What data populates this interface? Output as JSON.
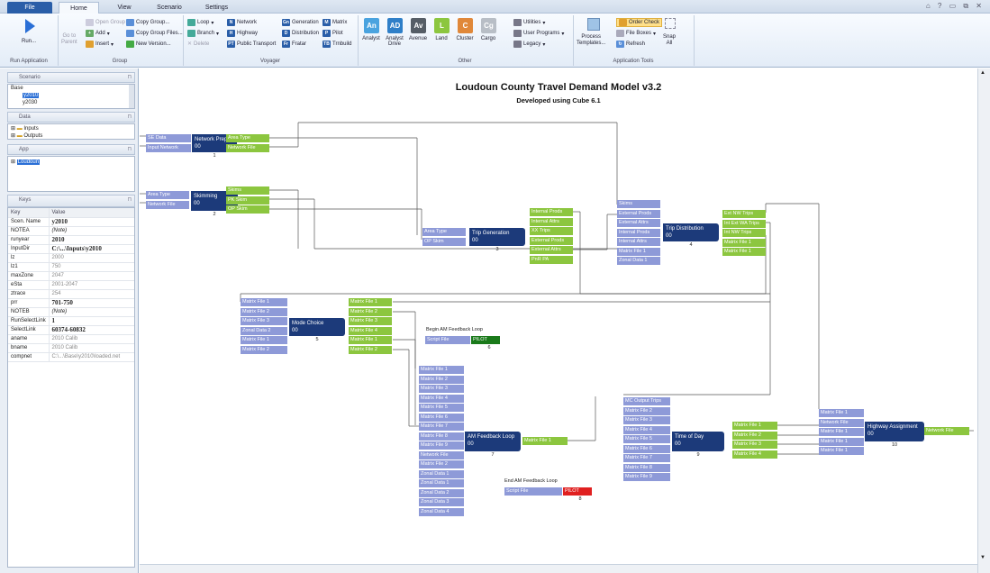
{
  "tabs": {
    "file": "File",
    "home": "Home",
    "view": "View",
    "scenario": "Scenario",
    "settings": "Settings"
  },
  "ribbon": {
    "run": "Run...",
    "run_group": "Run Application",
    "go_parent": "Go to\nParent",
    "open_group": "Open Group",
    "add": "Add",
    "insert": "Insert",
    "copy_group": "Copy Group...",
    "copy_group_files": "Copy Group Files...",
    "new_version": "New Version...",
    "group_caption": "Group",
    "loop": "Loop",
    "branch": "Branch",
    "delete": "Delete",
    "network": "Network",
    "highway": "Highway",
    "public_transport": "Public Transport",
    "generation": "Generation",
    "distribution": "Distribution",
    "fratar": "Fratar",
    "matrix": "Matrix",
    "pilot": "Pilot",
    "trnbuild": "Trnbuild",
    "voyager_caption": "Voyager",
    "tiles": [
      {
        "abbr": "An",
        "label": "Analyst",
        "color": "#4aa3df"
      },
      {
        "abbr": "AD",
        "label": "Analyst Drive",
        "color": "#2f7fc8"
      },
      {
        "abbr": "Av",
        "label": "Avenue",
        "color": "#555d66"
      },
      {
        "abbr": "L",
        "label": "Land",
        "color": "#8cc63f"
      },
      {
        "abbr": "C",
        "label": "Cluster",
        "color": "#e0883a"
      },
      {
        "abbr": "Cg",
        "label": "Cargo",
        "color": "#b8bec6"
      }
    ],
    "utilities": "Utilities",
    "user_programs": "User Programs",
    "legacy": "Legacy",
    "other_caption": "Other",
    "process_templates": "Process\nTemplates...",
    "order_check": "Order Check",
    "file_boxes": "File Boxes",
    "refresh": "Refresh",
    "snap_all": "Snap\nAll",
    "app_tools_caption": "Application Tools"
  },
  "panel": {
    "scenario_title": "Scenario",
    "scen_base": "Base",
    "scen_y2010": "y2010",
    "scen_y2030": "y2030",
    "data_title": "Data",
    "data_inputs": "Inputs",
    "data_outputs": "Outputs",
    "app_title": "App",
    "app_loudoun": "Loudoun",
    "keys_title": "Keys"
  },
  "keys": {
    "header": [
      "Key",
      "Value"
    ],
    "rows": [
      [
        "Scen. Name",
        "y2010"
      ],
      [
        "NOTEA",
        "(Note)"
      ],
      [
        "runyear",
        "2010"
      ],
      [
        "InputDir",
        "C:\\...\\Inputs\\y2010"
      ],
      [
        "lz",
        "2000"
      ],
      [
        "lz1",
        "750"
      ],
      [
        "maxZone",
        "2047"
      ],
      [
        "eSta",
        "2001-2047"
      ],
      [
        "ztrace",
        "254"
      ],
      [
        "prr",
        "701-750"
      ],
      [
        "NOTEB",
        "(Note)"
      ],
      [
        "RunSelectLink",
        "1"
      ],
      [
        "SelectLink",
        "60374-60832"
      ],
      [
        "aname",
        "2010 Calib"
      ],
      [
        "bname",
        "2010 Calib"
      ],
      [
        "compnet",
        "C:\\...\\Base\\y2010\\loaded.net"
      ]
    ]
  },
  "canvas": {
    "title": "Loudoun County Travel Demand Model v3.2",
    "subtitle": "Developed using Cube 6.1",
    "p1": {
      "name": "Network Prep",
      "code": "00",
      "num": "1",
      "in": [
        "SE Data",
        "Input Network"
      ],
      "out": [
        "Area Type",
        "Network File"
      ]
    },
    "p2": {
      "name": "Skimming",
      "code": "00",
      "num": "2",
      "in": [
        "Area Type",
        "Network File"
      ],
      "out": [
        "Skims",
        "PK Skim",
        "OP Skim"
      ]
    },
    "p3": {
      "name": "Trip Generation",
      "code": "00",
      "num": "3",
      "in": [
        "Area Type",
        "OP Skim"
      ],
      "out": [
        "Internal Prods",
        "Internal Attrs",
        "XX Trips",
        "External Prods",
        "External Attrs",
        "PnR PA"
      ]
    },
    "p4": {
      "name": "Trip Distribution",
      "code": "00",
      "num": "4",
      "in": [
        "Skims",
        "External Prods",
        "External Attrs",
        "Internal Prods",
        "Internal Attrs",
        "Matrix File 1",
        "Zonal Data 1"
      ],
      "out": [
        "Ext NW Trips",
        "Int Ext WA Trips",
        "Int NW Trips",
        "Matrix File 1",
        "Matrix File 1"
      ]
    },
    "p5": {
      "name": "Mode Choice",
      "code": "00",
      "num": "5",
      "in": [
        "Matrix File 1",
        "Matrix File 2",
        "Matrix File 3",
        "Zonal Data 2",
        "Matrix File 1",
        "Matrix File 2"
      ],
      "out": [
        "Matrix File 1",
        "Matrix File 2",
        "Matrix File 3",
        "Matrix File 4",
        "Matrix File 1",
        "Matrix File 2"
      ]
    },
    "p6": {
      "caption": "Begin AM Feedback Loop",
      "in": "Script File",
      "tag": "PILOT",
      "num": "6"
    },
    "p7": {
      "name": "AM Feedback Loop",
      "code": "00",
      "num": "7",
      "in": [
        "Matrix File 1",
        "Matrix File 2",
        "Matrix File 3",
        "Matrix File 4",
        "Matrix File 5",
        "Matrix File 6",
        "Matrix File 7",
        "Matrix File 8",
        "Matrix File 9",
        "Network File",
        "Matrix File 2",
        "Zonal Data 1",
        "Zonal Data 1",
        "Zonal Data 2",
        "Zonal Data 3",
        "Zonal Data 4"
      ],
      "out": [
        "Matrix File 1"
      ]
    },
    "p8": {
      "caption": "End AM Feedback Loop",
      "in": "Script File",
      "tag": "PILOT",
      "num": "8"
    },
    "p9": {
      "name": "Time of Day",
      "code": "00",
      "num": "9",
      "in": [
        "MC Output Trips",
        "Matrix File 2",
        "Matrix File 3",
        "Matrix File 4",
        "Matrix File 5",
        "Matrix File 6",
        "Matrix File 7",
        "Matrix File 8",
        "Matrix File 9"
      ],
      "out": [
        "Matrix File 1",
        "Matrix File 2",
        "Matrix File 3",
        "Matrix File 4"
      ]
    },
    "p10": {
      "name": "Highway Assignment",
      "code": "00",
      "num": "10",
      "in": [
        "Matrix File 1",
        "Network File",
        "Matrix File 1",
        "Matrix File 1",
        "Matrix File 1"
      ],
      "out": [
        "Network File"
      ]
    }
  },
  "colors": {
    "input": "#8e9ad8",
    "output": "#8cc63f",
    "process": "#1c3a7a",
    "pilot_green": "#1a7a1a",
    "pilot_red": "#e02020"
  }
}
